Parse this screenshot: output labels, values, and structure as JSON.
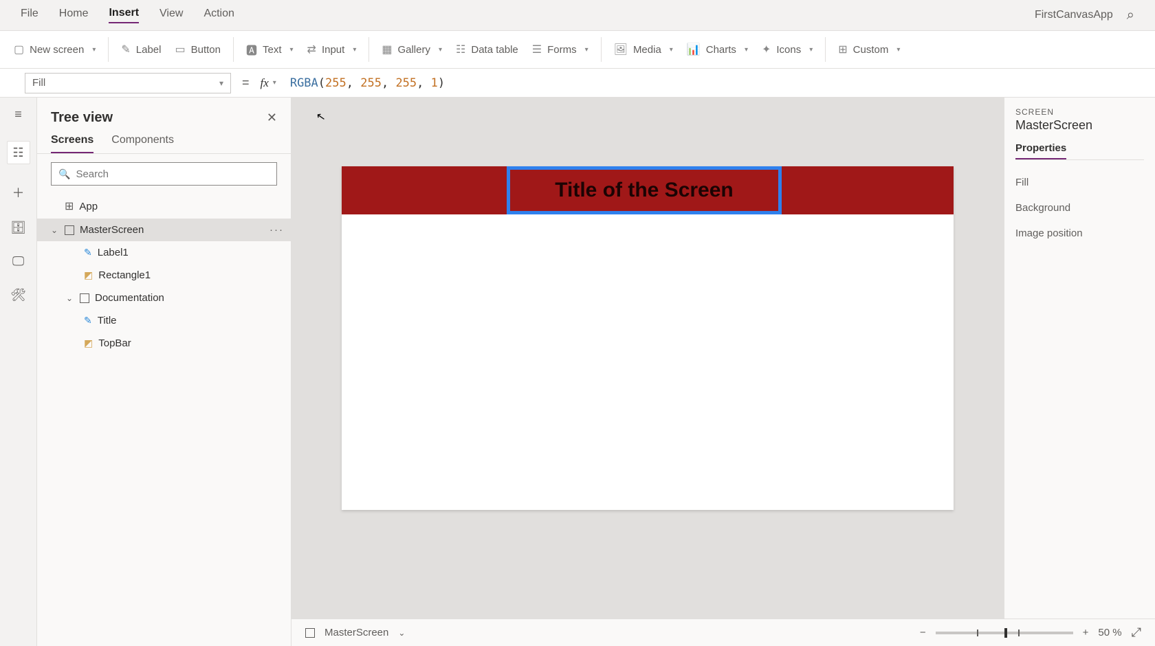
{
  "app_name": "FirstCanvasApp",
  "menu": {
    "items": [
      "File",
      "Home",
      "Insert",
      "View",
      "Action"
    ],
    "active_index": 2
  },
  "ribbon": {
    "new_screen": "New screen",
    "label": "Label",
    "button": "Button",
    "text": "Text",
    "input": "Input",
    "gallery": "Gallery",
    "data_table": "Data table",
    "forms": "Forms",
    "media": "Media",
    "charts": "Charts",
    "icons": "Icons",
    "custom": "Custom"
  },
  "formula": {
    "property": "Fill",
    "fx_label": "fx",
    "fn": "RGBA",
    "args": [
      "255",
      "255",
      "255",
      "1"
    ]
  },
  "tree": {
    "title": "Tree view",
    "tabs": {
      "screens": "Screens",
      "components": "Components",
      "active": "screens"
    },
    "search_placeholder": "Search",
    "app_node": "App",
    "screens": [
      {
        "name": "MasterScreen",
        "selected": true,
        "children": [
          {
            "name": "Label1",
            "type": "label"
          },
          {
            "name": "Rectangle1",
            "type": "rect"
          }
        ]
      },
      {
        "name": "Documentation",
        "selected": false,
        "children": [
          {
            "name": "Title",
            "type": "label"
          },
          {
            "name": "TopBar",
            "type": "rect"
          }
        ]
      }
    ]
  },
  "canvas": {
    "title_text": "Title of the Screen"
  },
  "right": {
    "header": "SCREEN",
    "screen_name": "MasterScreen",
    "tab": "Properties",
    "rows": [
      "Fill",
      "Background",
      "Image position"
    ]
  },
  "status": {
    "screen": "MasterScreen",
    "zoom": "50 %"
  }
}
